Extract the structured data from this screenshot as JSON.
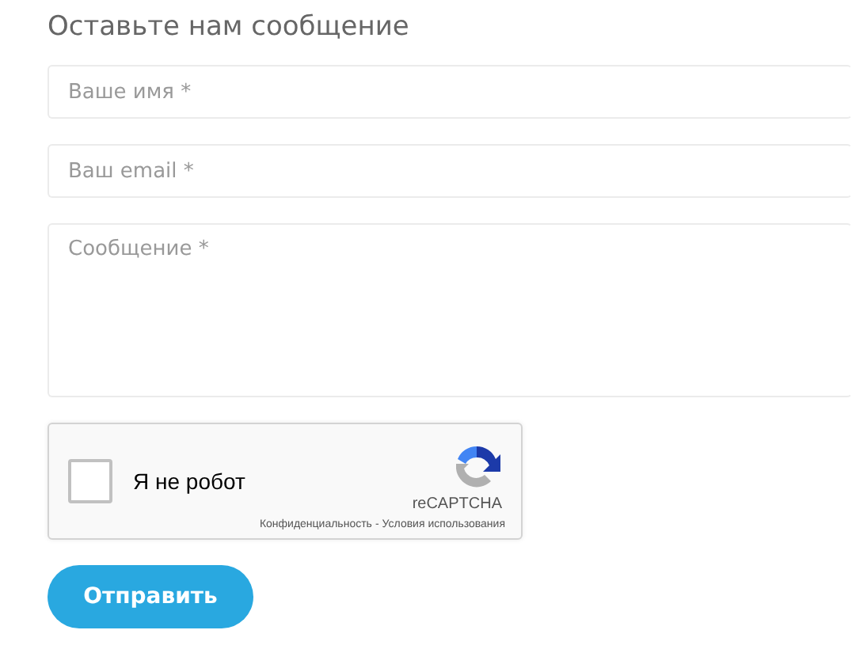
{
  "heading": "Оставьте нам сообщение",
  "fields": [
    {
      "kind": "input",
      "placeholder": "Ваше имя *"
    },
    {
      "kind": "input",
      "placeholder": "Ваш email *"
    },
    {
      "kind": "textarea",
      "placeholder": "Сообщение *"
    }
  ],
  "captcha": {
    "label": "Я не робот",
    "checked": false,
    "brand": "reCAPTCHA",
    "privacy": "Конфиденциальность",
    "separator": "-",
    "terms": "Условия использования"
  },
  "submit": "Отправить"
}
